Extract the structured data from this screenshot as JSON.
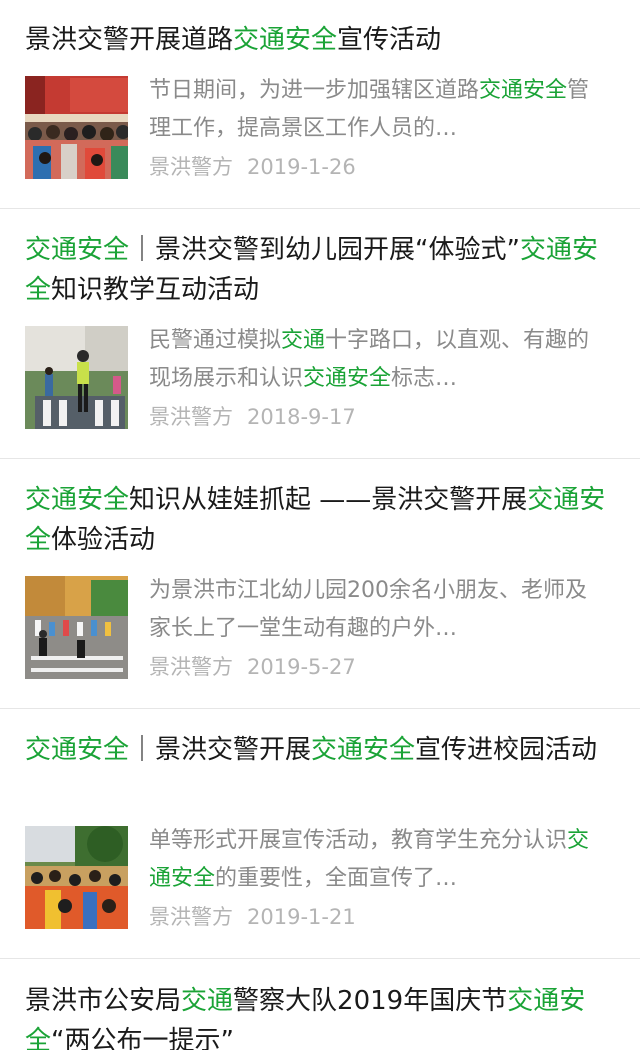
{
  "articles": [
    {
      "title_segments": [
        {
          "text": "景洪交警开展道路",
          "hl": false
        },
        {
          "text": "交通安全",
          "hl": true
        },
        {
          "text": "宣传活动",
          "hl": false
        }
      ],
      "summary_segments": [
        {
          "text": "节日期间，为进一步加强辖区道路",
          "hl": false
        },
        {
          "text": "交通安全",
          "hl": true
        },
        {
          "text": "管理工作，提高景区工作人员的…",
          "hl": false
        }
      ],
      "source": "景洪警方",
      "date": "2019-1-26",
      "thumbnail_icon": "photo-indoor-crowd"
    },
    {
      "title_segments": [
        {
          "text": "交通安全",
          "hl": true
        },
        {
          "text": "｜景洪交警到幼儿园开展“体验式”",
          "hl": false
        },
        {
          "text": "交通安全",
          "hl": true
        },
        {
          "text": "知识教学互动活动",
          "hl": false
        }
      ],
      "summary_segments": [
        {
          "text": "民警通过模拟",
          "hl": false
        },
        {
          "text": "交通",
          "hl": true
        },
        {
          "text": "十字路口，以直观、有趣的现场展示和认识",
          "hl": false
        },
        {
          "text": "交通安全",
          "hl": true
        },
        {
          "text": "标志…",
          "hl": false
        }
      ],
      "source": "景洪警方",
      "date": "2018-9-17",
      "thumbnail_icon": "photo-police-crosswalk"
    },
    {
      "title_segments": [
        {
          "text": "交通安全",
          "hl": true
        },
        {
          "text": "知识从娃娃抓起 ——景洪交警开展",
          "hl": false
        },
        {
          "text": "交通安全",
          "hl": true
        },
        {
          "text": "体验活动",
          "hl": false
        }
      ],
      "summary_segments": [
        {
          "text": "为景洪市江北幼儿园200余名小朋友、老师及家长上了一堂生动有趣的户外…",
          "hl": false
        }
      ],
      "source": "景洪警方",
      "date": "2019-5-27",
      "thumbnail_icon": "photo-kindergarten-outdoor"
    },
    {
      "title_segments": [
        {
          "text": "交通安全",
          "hl": true
        },
        {
          "text": "｜景洪交警开展",
          "hl": false
        },
        {
          "text": "交通安全",
          "hl": true
        },
        {
          "text": "宣传进校园活动",
          "hl": false
        }
      ],
      "summary_segments": [
        {
          "text": "单等形式开展宣传活动，教育学生充分认识",
          "hl": false
        },
        {
          "text": "交通安全",
          "hl": true
        },
        {
          "text": "的重要性，全面宣传了…",
          "hl": false
        }
      ],
      "source": "景洪警方",
      "date": "2019-1-21",
      "thumbnail_icon": "photo-students-crowd"
    },
    {
      "title_segments": [
        {
          "text": "景洪市公安局",
          "hl": false
        },
        {
          "text": "交通",
          "hl": true
        },
        {
          "text": "警察大队2019年国庆节",
          "hl": false
        },
        {
          "text": "交通安全",
          "hl": true
        },
        {
          "text": "“两公布一提示”",
          "hl": false
        }
      ],
      "summary_segments": [],
      "source": "",
      "date": "",
      "thumbnail_icon": ""
    }
  ],
  "colors": {
    "highlight": "#1aa336",
    "title": "#1a1a1a",
    "summary": "#8a8a8a",
    "meta": "#b4b4b4",
    "divider": "#e6e6e6"
  }
}
